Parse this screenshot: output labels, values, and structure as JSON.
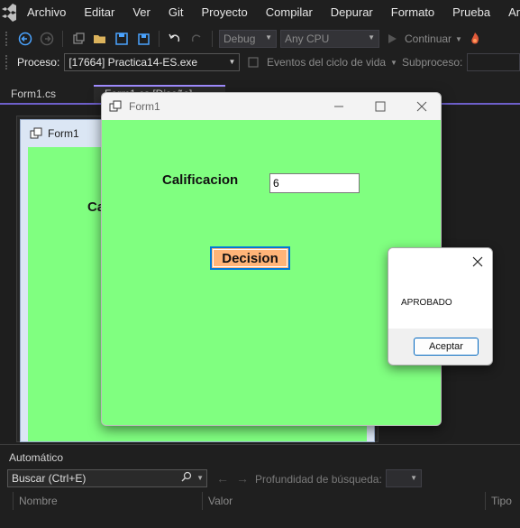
{
  "menu": [
    "Archivo",
    "Editar",
    "Ver",
    "Git",
    "Proyecto",
    "Compilar",
    "Depurar",
    "Formato",
    "Prueba",
    "Analiz"
  ],
  "toolbar": {
    "config": "Debug",
    "platform": "Any CPU",
    "continue_label": "Continuar"
  },
  "procbar": {
    "label": "Proceso:",
    "process": "[17664] Practica14-ES.exe",
    "lifecycle": "Eventos del ciclo de vida",
    "thread_label": "Subproceso:"
  },
  "tabs": [
    "Form1.cs",
    "Form1.cs [Diseño]"
  ],
  "design_form": {
    "title": "Form1",
    "label_partial": "Ca"
  },
  "run_form": {
    "title": "Form1",
    "calif_label": "Calificacion",
    "calif_value": "6",
    "decision_label": "Decision"
  },
  "message_box": {
    "text": "APROBADO",
    "ok_label": "Aceptar"
  },
  "autos": {
    "title": "Automático",
    "search_placeholder": "Buscar (Ctrl+E)",
    "depth_label": "Profundidad de búsqueda:",
    "columns": [
      "Nombre",
      "Valor",
      "Tipo"
    ]
  },
  "colors": {
    "form_bg": "#80ff80",
    "button_bg": "#ffb478",
    "accent": "#0078d7",
    "ide_bg": "#1f1f1f"
  }
}
